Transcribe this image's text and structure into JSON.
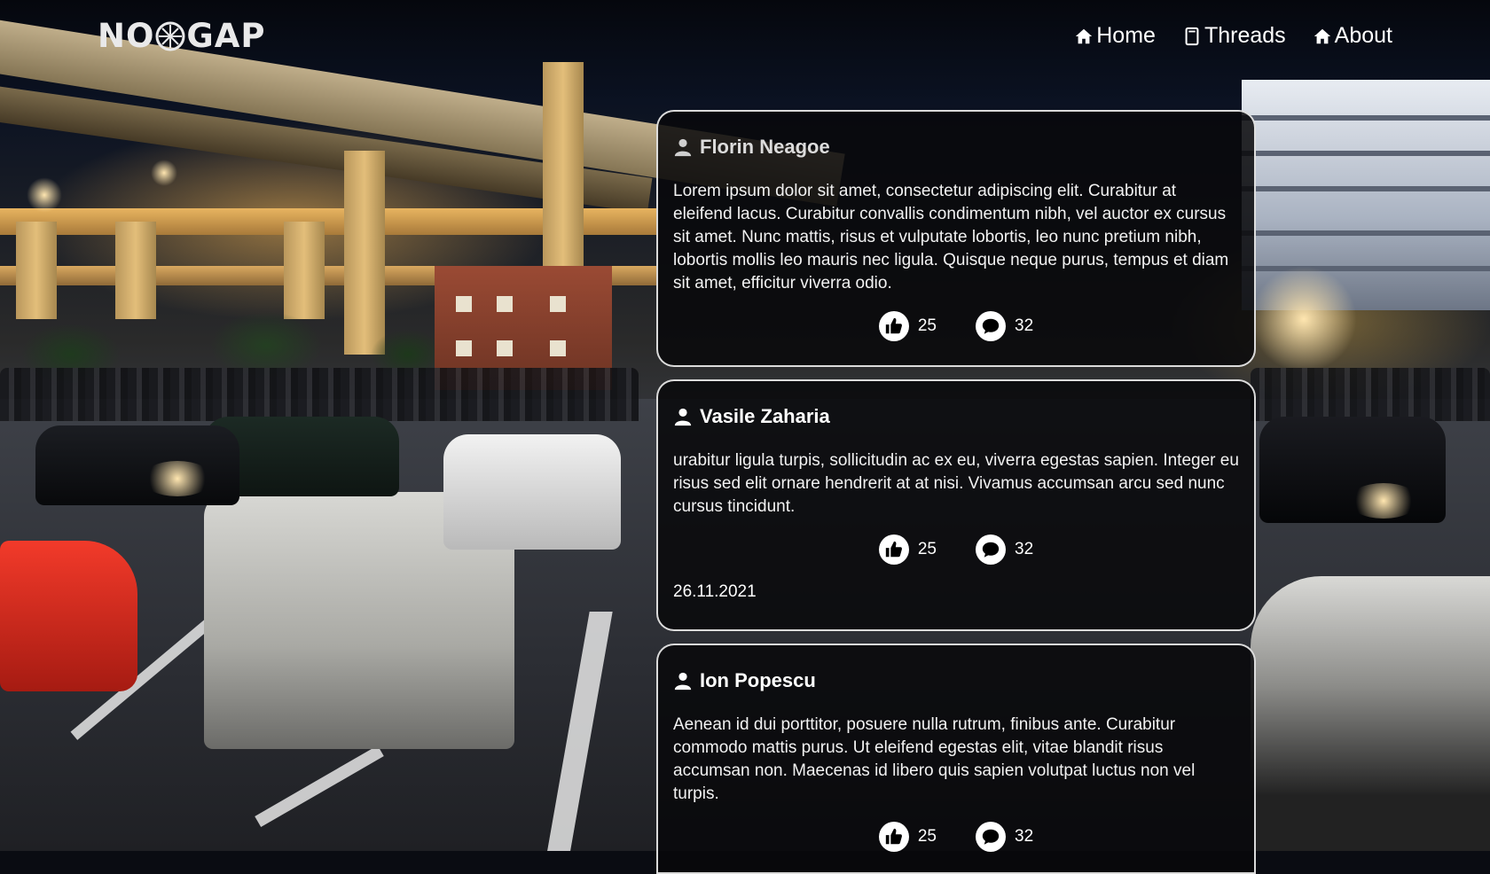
{
  "brand": {
    "logo_left": "NO",
    "logo_right": "GAP"
  },
  "nav": {
    "items": [
      {
        "label": "Home",
        "icon": "home-icon"
      },
      {
        "label": "Threads",
        "icon": "threads-icon"
      },
      {
        "label": "About",
        "icon": "about-icon"
      }
    ]
  },
  "posts": [
    {
      "author": "Florin Neagoe",
      "body": "Lorem ipsum dolor sit amet, consectetur adipiscing elit. Curabitur at eleifend lacus. Curabitur convallis condimentum nibh, vel auctor ex cursus sit amet. Nunc mattis, risus et vulputate lobortis, leo nunc pretium nibh, lobortis mollis leo mauris nec ligula. Quisque neque purus, tempus et diam sit amet, efficitur viverra odio.",
      "likes": "25",
      "comments": "32"
    },
    {
      "author": "Vasile Zaharia",
      "body": "urabitur ligula turpis, sollicitudin ac ex eu, viverra egestas sapien. Integer eu risus sed elit ornare hendrerit at at nisi. Vivamus accumsan arcu sed nunc cursus tincidunt.",
      "likes": "25",
      "comments": "32",
      "date": "26.11.2021"
    },
    {
      "author": "Ion Popescu",
      "body": "Aenean id dui porttitor, posuere nulla rutrum, finibus ante. Curabitur commodo mattis purus. Ut eleifend egestas elit, vitae blandit risus accumsan non. Maecenas id libero quis sapien volutpat luctus non vel turpis.",
      "likes": "25",
      "comments": "32"
    }
  ],
  "colors": {
    "card_bg": "#08080a",
    "card_border": "#ffffff",
    "text": "#ffffff"
  }
}
